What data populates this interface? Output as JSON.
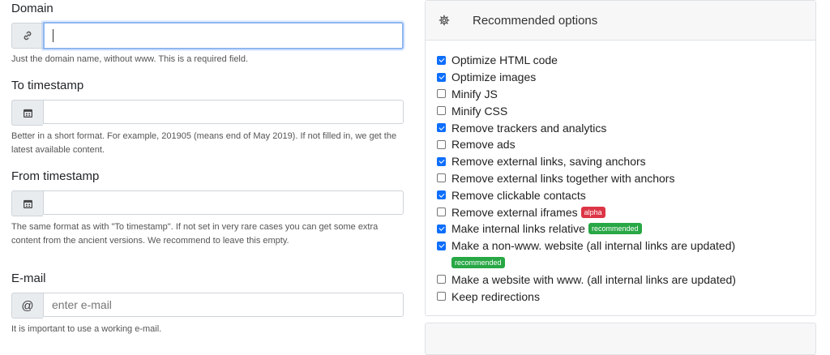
{
  "form": {
    "domain": {
      "label": "Domain",
      "value": "",
      "help": "Just the domain name, without www. This is a required field."
    },
    "to_timestamp": {
      "label": "To timestamp",
      "value": "",
      "help": "Better in a short format. For example, 201905 (means end of May 2019). If not filled in, we get the latest available content."
    },
    "from_timestamp": {
      "label": "From timestamp",
      "value": "",
      "help": "The same format as with \"To timestamp\". If not set in very rare cases you can get some extra content from the ancient versions. We recommend to leave this empty."
    },
    "email": {
      "label": "E-mail",
      "placeholder": "enter e-mail",
      "addon": "@",
      "help": "It is important to use a working e-mail."
    }
  },
  "options_panel": {
    "title": "Recommended options",
    "items": [
      {
        "label": "Optimize HTML code",
        "checked": true
      },
      {
        "label": "Optimize images",
        "checked": true
      },
      {
        "label": "Minify JS",
        "checked": false
      },
      {
        "label": "Minify CSS",
        "checked": false
      },
      {
        "label": "Remove trackers and analytics",
        "checked": true
      },
      {
        "label": "Remove ads",
        "checked": false
      },
      {
        "label": "Remove external links, saving anchors",
        "checked": true
      },
      {
        "label": "Remove external links together with anchors",
        "checked": false
      },
      {
        "label": "Remove clickable contacts",
        "checked": true
      },
      {
        "label": "Remove external iframes",
        "checked": false,
        "badge": "alpha"
      },
      {
        "label": "Make internal links relative",
        "checked": true,
        "badge": "recommended"
      },
      {
        "label": "Make a non-www. website (all internal links are updated)",
        "checked": true,
        "badge_line": "recommended"
      },
      {
        "label": "Make a website with www. (all internal links are updated)",
        "checked": false
      },
      {
        "label": "Keep redirections",
        "checked": false
      }
    ]
  },
  "colors": {
    "accent": "#0d6efd",
    "alpha_badge": "#dc3545",
    "recommended_badge": "#28a745"
  }
}
